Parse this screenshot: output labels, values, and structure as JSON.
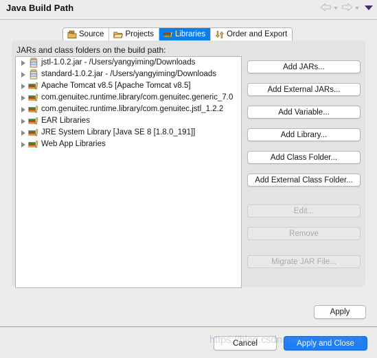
{
  "window": {
    "title": "Java Build Path",
    "nav": {
      "back_icon": "back-arrow-icon",
      "back_dropdown_icon": "caret-down-icon",
      "forward_icon": "forward-arrow-icon",
      "forward_dropdown_icon": "caret-down-icon",
      "menu_icon": "dropdown-arrow-icon"
    }
  },
  "tabs": [
    {
      "label": "Source",
      "icon": "source-folder-icon",
      "active": false
    },
    {
      "label": "Projects",
      "icon": "projects-folder-icon",
      "active": false
    },
    {
      "label": "Libraries",
      "icon": "libraries-books-icon",
      "active": true
    },
    {
      "label": "Order and Export",
      "icon": "order-export-arrows-icon",
      "active": false
    }
  ],
  "panel": {
    "label": "JARs and class folders on the build path:"
  },
  "tree": {
    "items": [
      {
        "label": "jstl-1.0.2.jar - /Users/yangyiming/Downloads",
        "icon": "jar-icon",
        "expandable": true
      },
      {
        "label": "standard-1.0.2.jar - /Users/yangyiming/Downloads",
        "icon": "jar-icon",
        "expandable": true
      },
      {
        "label": "Apache Tomcat v8.5 [Apache Tomcat v8.5]",
        "icon": "library-icon",
        "expandable": true
      },
      {
        "label": "com.genuitec.runtime.library/com.genuitec.generic_7.0",
        "icon": "library-icon",
        "expandable": true
      },
      {
        "label": "com.genuitec.runtime.library/com.genuitec.jstl_1.2.2",
        "icon": "library-icon",
        "expandable": true
      },
      {
        "label": "EAR Libraries",
        "icon": "library-icon",
        "expandable": true
      },
      {
        "label": "JRE System Library [Java SE 8 [1.8.0_191]]",
        "icon": "library-icon",
        "expandable": true
      },
      {
        "label": "Web App Libraries",
        "icon": "library-icon",
        "expandable": true
      }
    ]
  },
  "buttons": [
    {
      "label": "Add JARs...",
      "enabled": true
    },
    {
      "label": "Add External JARs...",
      "enabled": true
    },
    {
      "label": "Add Variable...",
      "enabled": true
    },
    {
      "label": "Add Library...",
      "enabled": true
    },
    {
      "label": "Add Class Folder...",
      "enabled": true
    },
    {
      "label": "Add External Class Folder...",
      "enabled": true
    },
    {
      "label": "Edit...",
      "enabled": false
    },
    {
      "label": "Remove",
      "enabled": false
    },
    {
      "label": "Migrate JAR File...",
      "enabled": false
    }
  ],
  "footer": {
    "apply_label": "Apply",
    "cancel_label": "Cancel",
    "apply_and_close_label": "Apply and Close"
  },
  "watermark": {
    "text": "https://blog.csdn.net/qq_39009205"
  }
}
